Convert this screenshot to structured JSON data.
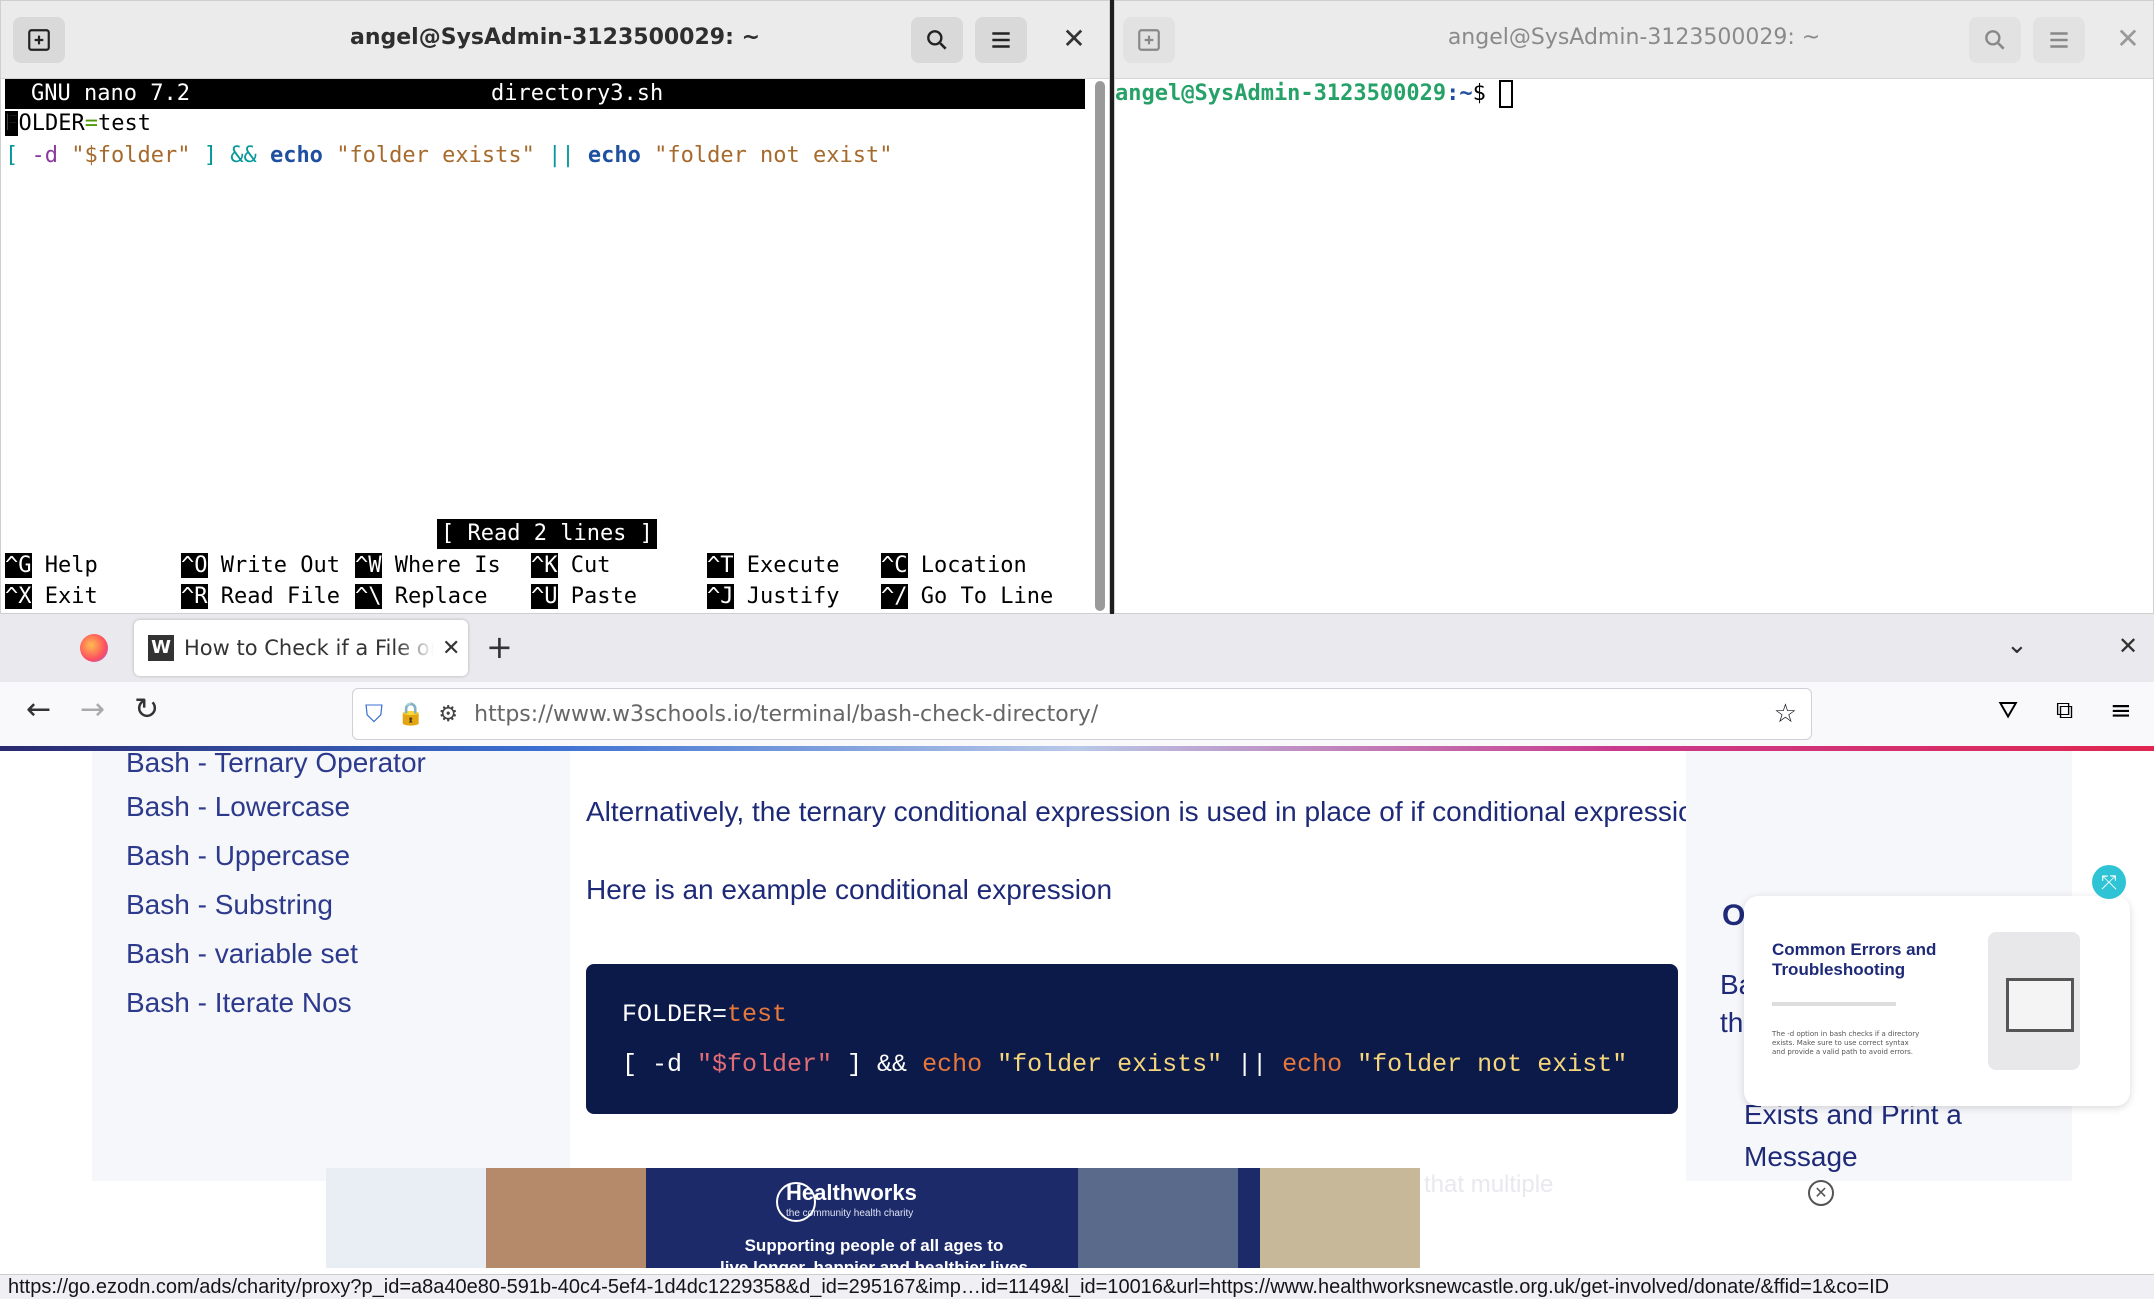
{
  "term_left": {
    "title": "angel@SysAdmin-3123500029: ~",
    "nano_header": {
      "version": "GNU nano 7.2",
      "filename": "directory3.sh"
    },
    "code_line1": {
      "var": "FOLDER",
      "eq": "=",
      "val": "test"
    },
    "code_line2": {
      "open": "[",
      "flag": " -d ",
      "arg": "\"$folder\"",
      "close": " ] ",
      "and": "&&",
      "echo1": " echo ",
      "str1": "\"folder exists\"",
      "or": " || ",
      "echo2": "echo ",
      "str2": "\"folder not exist\""
    },
    "status_msg": "[ Read 2 lines ]",
    "shortcuts_row1": [
      {
        "key": "^G",
        "label": "Help"
      },
      {
        "key": "^O",
        "label": "Write Out"
      },
      {
        "key": "^W",
        "label": "Where Is"
      },
      {
        "key": "^K",
        "label": "Cut"
      },
      {
        "key": "^T",
        "label": "Execute"
      },
      {
        "key": "^C",
        "label": "Location"
      }
    ],
    "shortcuts_row2": [
      {
        "key": "^X",
        "label": "Exit"
      },
      {
        "key": "^R",
        "label": "Read File"
      },
      {
        "key": "^\\",
        "label": "Replace"
      },
      {
        "key": "^U",
        "label": "Paste"
      },
      {
        "key": "^J",
        "label": "Justify"
      },
      {
        "key": "^/",
        "label": "Go To Line"
      }
    ]
  },
  "term_right": {
    "title": "angel@SysAdmin-3123500029: ~",
    "prompt_user": "angel@SysAdmin-3123500029",
    "prompt_path": ":~",
    "prompt_sign": "$ "
  },
  "browser": {
    "tab_title": "How to Check if a File or Directory",
    "url_host": "https://www.w3schools.io",
    "url_path": "/terminal/bash-check-directory/",
    "sidebar_partial": "Bash - Ternary Operator",
    "sidebar_items": [
      "Bash - Lowercase",
      "Bash - Uppercase",
      "Bash - Substring",
      "Bash - variable set",
      "Bash - Iterate Nos"
    ],
    "para1": "Alternatively, the ternary conditional expression is used in place of if conditional expressions.",
    "para2": "Here is an example conditional expression",
    "code": {
      "l1_var": "FOLDER=",
      "l1_val": "test",
      "l2_a": "[ -d ",
      "l2_b": "\"$folder\"",
      "l2_c": " ] && ",
      "l2_d": "echo",
      "l2_e": " \"folder exists\"",
      "l2_f": " || ",
      "l2_g": "echo",
      "l2_h": " \"folder not exist\""
    },
    "right_frag1": "O",
    "right_frag2": "Ba",
    "right_frag3": "th",
    "right_link": "Exists and Print a",
    "right_link2": "Message",
    "ad_card_title": "Common Errors and Troubleshooting",
    "ad_card_small": "The -d option in bash checks if a directory exists. Make sure to use correct syntax and provide a valid path to avoid errors.",
    "bottom_ad_brand": "Healthworks",
    "bottom_ad_sub": "the community health charity",
    "bottom_ad_tag": "Supporting people of all ages to",
    "bottom_ad_tag2": "live longer, happier and healthier lives",
    "faded_text": "that multiple",
    "status_url": "https://go.ezodn.com/ads/charity/proxy?p_id=a8a40e80-591b-40c4-5ef4-1d4dc1229358&d_id=295167&imp…id=1149&l_id=10016&url=https://www.healthworksnewcastle.org.uk/get-involved/donate/&ffid=1&co=ID"
  },
  "colors": {
    "nano_green": "#4e9a06",
    "nano_blue": "#1f4fa0",
    "nano_brown": "#a66a2c",
    "nano_cyan": "#06989a",
    "prompt_green": "#26a269",
    "code_orange": "#e7783a",
    "code_red": "#e06c75",
    "code_yellow": "#f5d67b"
  }
}
